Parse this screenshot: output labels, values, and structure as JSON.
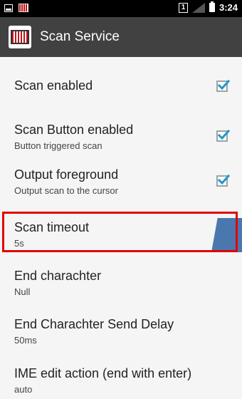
{
  "status_bar": {
    "time": "3:24",
    "sim_slot": "1"
  },
  "app_bar": {
    "title": "Scan Service",
    "logo_icon": "barcode-icon"
  },
  "colors": {
    "app_bar": "#414141",
    "checkbox_accent": "#2196c9",
    "highlight": "#e00000"
  },
  "settings": [
    {
      "title": "Scan enabled",
      "summary": "",
      "checked": true
    },
    {
      "title": "Scan Button enabled",
      "summary": "Button triggered scan",
      "checked": true
    },
    {
      "title": "Output foreground",
      "summary": "Output scan to the cursor",
      "checked": true
    },
    {
      "title": "Scan timeout",
      "summary": "5s"
    },
    {
      "title": "End charachter",
      "summary": "Null"
    },
    {
      "title": "End Charachter Send Delay",
      "summary": "50ms"
    },
    {
      "title": "IME edit action (end with enter)",
      "summary": "auto"
    }
  ]
}
